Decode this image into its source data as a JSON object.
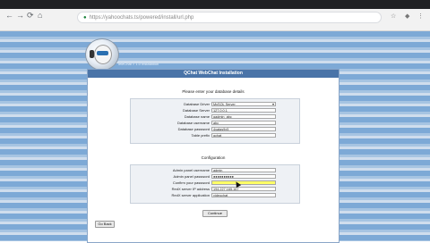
{
  "browser": {
    "url": "https://yahoochats.ts/powered/install/url.php",
    "back": "←",
    "forward": "→",
    "reload": "⟳",
    "home": "⌂",
    "lock": "🔒"
  },
  "header": {
    "breadcrumb": "TeleChat > 1.0 Installation"
  },
  "panel": {
    "title": "QChat WebChat Installation",
    "intro": "Please enter your database details",
    "database": [
      {
        "label": "Database Driver",
        "value": "MySQL Server",
        "select": true
      },
      {
        "label": "Database Server",
        "value": "127.0.0.1"
      },
      {
        "label": "Database name",
        "value": "qadmin_abc"
      },
      {
        "label": "Database username",
        "value": "abc"
      },
      {
        "label": "Database password",
        "value": "4yatqs9x5"
      },
      {
        "label": "Table prefix",
        "value": "qchat_"
      }
    ],
    "config_heading": "Configuration",
    "config": [
      {
        "label": "Admin panel username",
        "value": "admin"
      },
      {
        "label": "Admin panel password",
        "value": "●●●●●●●●●●"
      },
      {
        "label": "Confirm your password",
        "value": "",
        "highlight": true
      },
      {
        "label": "RedX server IP address",
        "value": "194.227.165.167"
      },
      {
        "label": "RedX server application",
        "value": "videochat"
      }
    ],
    "continue_label": "Continue",
    "back_label": "Go Back"
  }
}
